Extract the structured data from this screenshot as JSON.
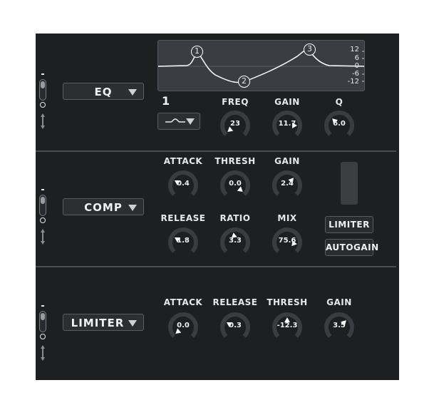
{
  "eq": {
    "module": "EQ",
    "band": "1",
    "scale": [
      "12",
      "6",
      "0",
      "-6",
      "-12"
    ],
    "nodes": [
      "1",
      "2",
      "3"
    ],
    "knobs": [
      {
        "label": "FREQ",
        "value": "23"
      },
      {
        "label": "GAIN",
        "value": "11.7"
      },
      {
        "label": "Q",
        "value": "6.0"
      }
    ]
  },
  "comp": {
    "module": "COMP",
    "knobs": [
      {
        "label": "ATTACK",
        "value": "0.4"
      },
      {
        "label": "THRESH",
        "value": "0.0"
      },
      {
        "label": "GAIN",
        "value": "2.4"
      },
      {
        "label": "RELEASE",
        "value": "1.8"
      },
      {
        "label": "RATIO",
        "value": "3.3"
      },
      {
        "label": "MIX",
        "value": "75.6"
      }
    ],
    "limiter_button": "LIMITER",
    "autogain_button": "AUTOGAIN"
  },
  "limiter": {
    "module": "LIMITER",
    "knobs": [
      {
        "label": "ATTACK",
        "value": "0.0"
      },
      {
        "label": "RELEASE",
        "value": "0.3"
      },
      {
        "label": "THRESH",
        "value": "-12.3"
      },
      {
        "label": "GAIN",
        "value": "3.5"
      }
    ]
  },
  "colors": {
    "panel": "#1e1f21",
    "knob_arc": "#3a3c40",
    "accent": "#ffffff"
  }
}
